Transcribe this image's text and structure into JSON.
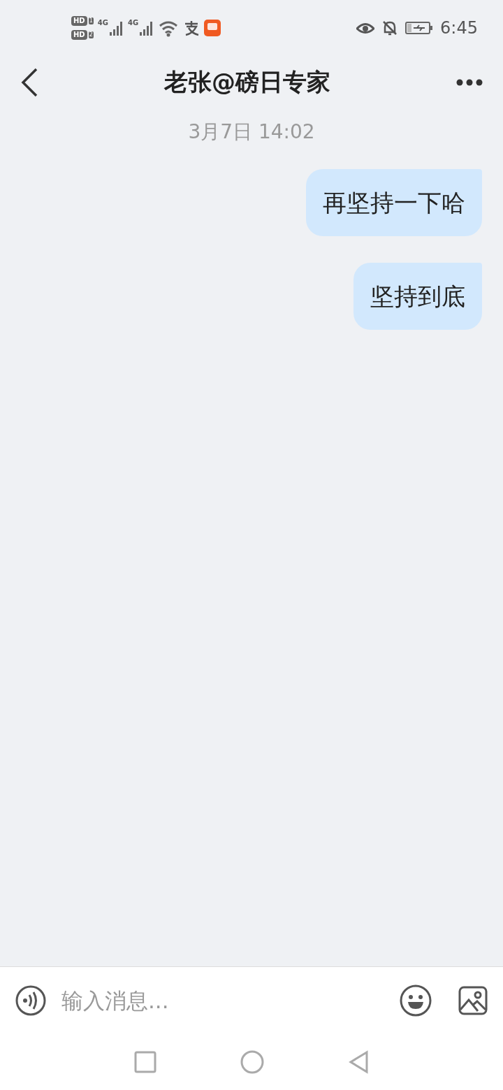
{
  "status_bar": {
    "sims": [
      {
        "badge": "HD",
        "slot": "1",
        "network": "4G"
      },
      {
        "badge": "HD",
        "slot": "2",
        "network": "4G"
      }
    ],
    "time": "6:45"
  },
  "header": {
    "title": "老张@磅日专家"
  },
  "timestamp": "3月7日 14:02",
  "messages": [
    {
      "text": "再坚持一下哈",
      "outgoing": true
    },
    {
      "text": "坚持到底",
      "outgoing": true
    }
  ],
  "composer": {
    "placeholder": "输入消息..."
  }
}
